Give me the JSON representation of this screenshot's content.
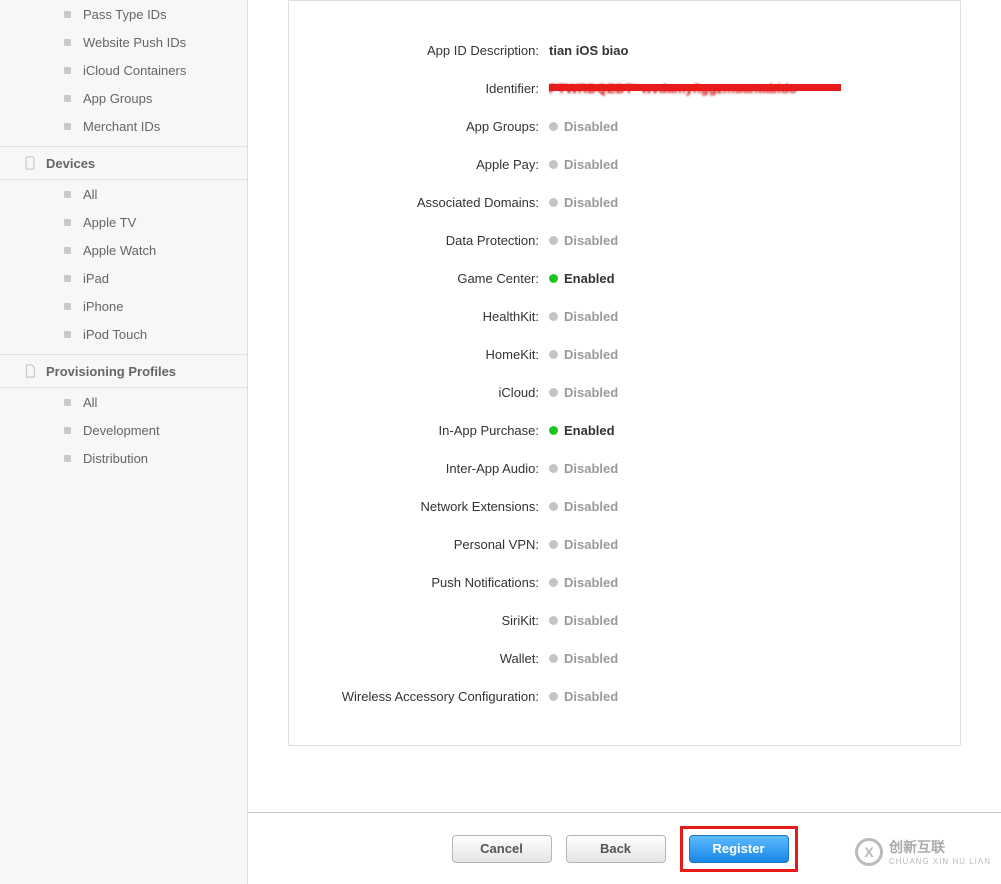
{
  "sidebar": {
    "group_top": [
      "Pass Type IDs",
      "Website Push IDs",
      "iCloud Containers",
      "App Groups",
      "Merchant IDs"
    ],
    "devices_header": "Devices",
    "group_devices": [
      "All",
      "Apple TV",
      "Apple Watch",
      "iPad",
      "iPhone",
      "iPod Touch"
    ],
    "provisioning_header": "Provisioning Profiles",
    "group_provisioning": [
      "All",
      "Development",
      "Distribution"
    ]
  },
  "panel": {
    "desc_label": "App ID Description:",
    "desc_value": "tian iOS biao",
    "identifier_label": "Identifier:",
    "identifier_display": "PTWRDQEDT* wvdamyñggzmuantabido",
    "services": [
      {
        "label": "App Groups:",
        "status": "Disabled"
      },
      {
        "label": "Apple Pay:",
        "status": "Disabled"
      },
      {
        "label": "Associated Domains:",
        "status": "Disabled"
      },
      {
        "label": "Data Protection:",
        "status": "Disabled"
      },
      {
        "label": "Game Center:",
        "status": "Enabled"
      },
      {
        "label": "HealthKit:",
        "status": "Disabled"
      },
      {
        "label": "HomeKit:",
        "status": "Disabled"
      },
      {
        "label": "iCloud:",
        "status": "Disabled"
      },
      {
        "label": "In-App Purchase:",
        "status": "Enabled"
      },
      {
        "label": "Inter-App Audio:",
        "status": "Disabled"
      },
      {
        "label": "Network Extensions:",
        "status": "Disabled"
      },
      {
        "label": "Personal VPN:",
        "status": "Disabled"
      },
      {
        "label": "Push Notifications:",
        "status": "Disabled"
      },
      {
        "label": "SiriKit:",
        "status": "Disabled"
      },
      {
        "label": "Wallet:",
        "status": "Disabled"
      },
      {
        "label": "Wireless Accessory Configuration:",
        "status": "Disabled"
      }
    ]
  },
  "footer": {
    "cancel": "Cancel",
    "back": "Back",
    "register": "Register"
  },
  "watermark": {
    "brand": "创新互联",
    "sub": "CHUANG XIN HU LIAN",
    "mark": "X"
  }
}
